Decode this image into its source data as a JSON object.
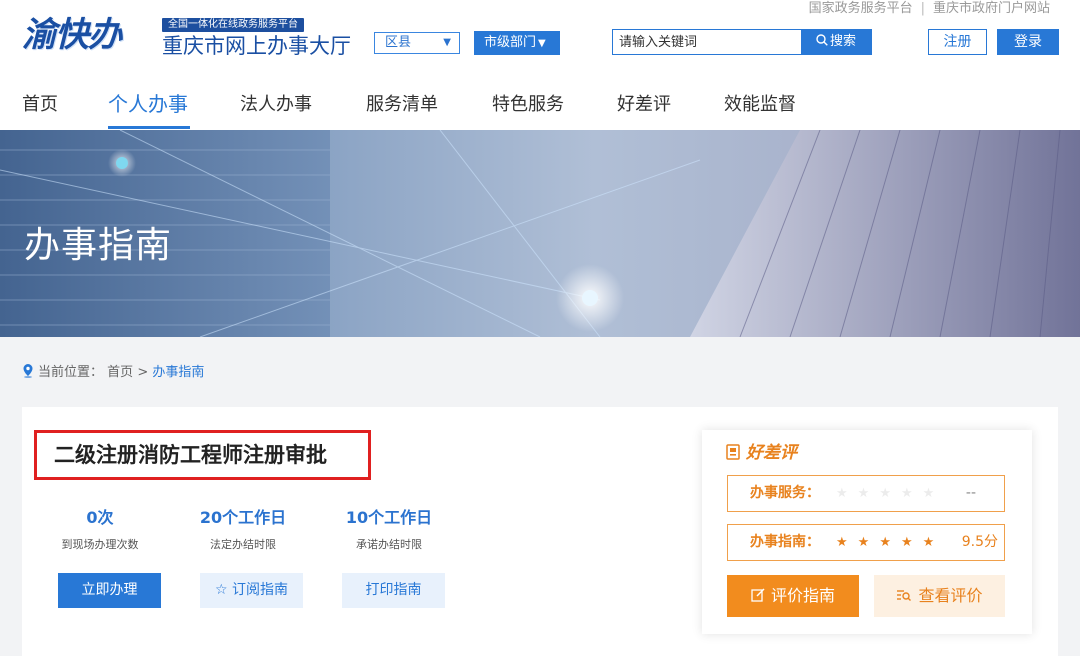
{
  "top_links": [
    "国家政务服务平台",
    "重庆市政府门户网站"
  ],
  "logo": {
    "brand": "渝快办",
    "slogan": "全国一体化在线政务服务平台",
    "hall": "重庆市网上办事大厅"
  },
  "selectors": {
    "district": "区县",
    "city": "市级部门"
  },
  "search": {
    "placeholder": "请输入关键词",
    "button": "搜索"
  },
  "auth": {
    "register": "注册",
    "login": "登录"
  },
  "nav": [
    "首页",
    "个人办事",
    "法人办事",
    "服务清单",
    "特色服务",
    "好差评",
    "效能监督"
  ],
  "banner": {
    "title": "办事指南"
  },
  "breadcrumb": {
    "label": "当前位置：",
    "home": "首页",
    "sep": ">",
    "current": "办事指南"
  },
  "guide": {
    "title": "二级注册消防工程师注册审批",
    "stats": [
      {
        "value": "0次",
        "label": "到现场办理次数"
      },
      {
        "value": "20个工作日",
        "label": "法定办结时限"
      },
      {
        "value": "10个工作日",
        "label": "承诺办结时限"
      }
    ],
    "actions": {
      "apply": "立即办理",
      "subscribe": "订阅指南",
      "print": "打印指南"
    }
  },
  "rating": {
    "title": "好差评",
    "service": {
      "label": "办事服务：",
      "score": "--",
      "stars": 0
    },
    "guide": {
      "label": "办事指南：",
      "score": "9.5分",
      "stars": 4.5
    },
    "evaluate": "评价指南",
    "view": "查看评价"
  },
  "colors": {
    "primary": "#2878d6",
    "orange": "#f28c1e",
    "highlight": "#e02020"
  }
}
